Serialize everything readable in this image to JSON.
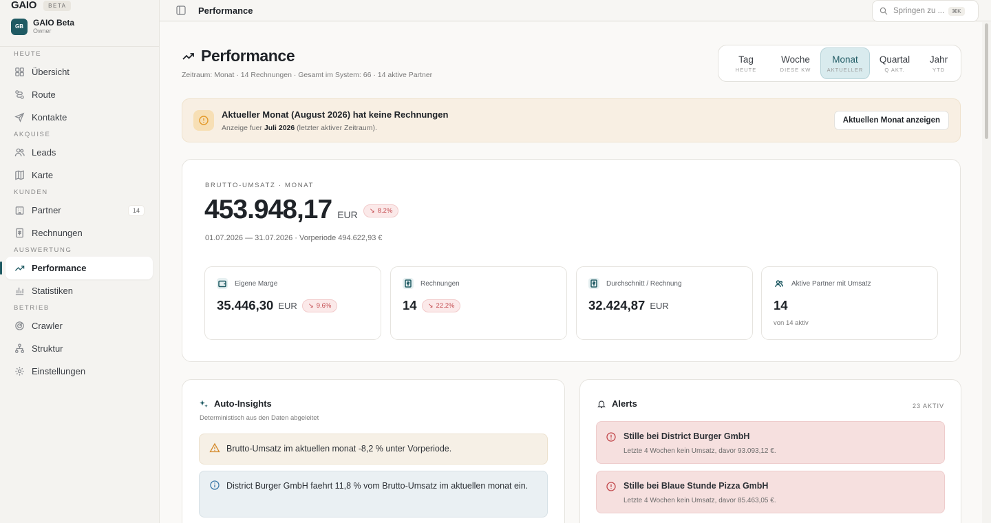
{
  "brand": {
    "name": "GAIO",
    "badge": "BETA"
  },
  "org": {
    "initials": "GB",
    "name": "GAIO Beta",
    "role": "Owner"
  },
  "nav": {
    "sections": [
      {
        "title": "HEUTE",
        "items": [
          {
            "label": "Übersicht",
            "icon": "grid-icon"
          },
          {
            "label": "Route",
            "icon": "route-icon"
          },
          {
            "label": "Kontakte",
            "icon": "send-icon"
          }
        ]
      },
      {
        "title": "AKQUISE",
        "items": [
          {
            "label": "Leads",
            "icon": "users-icon"
          },
          {
            "label": "Karte",
            "icon": "map-icon"
          }
        ]
      },
      {
        "title": "KUNDEN",
        "items": [
          {
            "label": "Partner",
            "icon": "building-icon",
            "count": "14"
          },
          {
            "label": "Rechnungen",
            "icon": "receipt-icon"
          }
        ]
      },
      {
        "title": "AUSWERTUNG",
        "items": [
          {
            "label": "Performance",
            "icon": "trend-icon",
            "active": true
          },
          {
            "label": "Statistiken",
            "icon": "bar-chart-icon"
          }
        ]
      },
      {
        "title": "BETRIEB",
        "items": [
          {
            "label": "Crawler",
            "icon": "radar-icon"
          },
          {
            "label": "Struktur",
            "icon": "hierarchy-icon"
          },
          {
            "label": "Einstellungen",
            "icon": "gear-icon"
          }
        ]
      }
    ]
  },
  "topbar": {
    "breadcrumb": "Performance",
    "search_placeholder": "Springen zu ...",
    "shortcut": "⌘K"
  },
  "page": {
    "title": "Performance",
    "subtitle": "Zeitraum: Monat · 14 Rechnungen · Gesamt im System: 66 · 14 aktive Partner"
  },
  "period_tabs": [
    {
      "label": "Tag",
      "sub": "HEUTE"
    },
    {
      "label": "Woche",
      "sub": "DIESE KW"
    },
    {
      "label": "Monat",
      "sub": "AKTUELLER",
      "active": true
    },
    {
      "label": "Quartal",
      "sub": "Q AKT."
    },
    {
      "label": "Jahr",
      "sub": "YTD"
    }
  ],
  "banner": {
    "title": "Aktueller Monat (August 2026) hat keine Rechnungen",
    "desc_prefix": "Anzeige fuer ",
    "desc_bold": "Juli 2026",
    "desc_suffix": " (letzter aktiver Zeitraum).",
    "button": "Aktuellen Monat anzeigen",
    "accent": "#f0a93b"
  },
  "revenue": {
    "eyebrow": "BRUTTO-UMSATZ · MONAT",
    "value": "453.948,17",
    "currency": "EUR",
    "delta": "8.2%",
    "range": "01.07.2026 — 31.07.2026 · Vorperiode 494.622,93 €"
  },
  "kpis": [
    {
      "label": "Eigene Marge",
      "value": "35.446,30",
      "currency": "EUR",
      "delta": "9.6%",
      "icon": "wallet-icon"
    },
    {
      "label": "Rechnungen",
      "value": "14",
      "delta": "22.2%",
      "icon": "invoice-icon"
    },
    {
      "label": "Durchschnitt / Rechnung",
      "value": "32.424,87",
      "currency": "EUR",
      "icon": "invoice-icon"
    },
    {
      "label": "Aktive Partner mit Umsatz",
      "value": "14",
      "note": "von 14 aktiv",
      "icon": "users-icon"
    }
  ],
  "insights": {
    "title": "Auto-Insights",
    "subtitle": "Deterministisch aus den Daten abgeleitet",
    "items": [
      {
        "kind": "warning",
        "text": "Brutto-Umsatz im aktuellen monat -8,2 % unter Vorperiode."
      },
      {
        "kind": "info",
        "text": "District Burger GmbH faehrt 11,8 % vom Brutto-Umsatz im aktuellen monat ein."
      }
    ]
  },
  "alerts": {
    "title": "Alerts",
    "count": "23 AKTIV",
    "items": [
      {
        "title": "Stille bei District Burger GmbH",
        "desc": "Letzte 4 Wochen kein Umsatz, davor 93.093,12 €."
      },
      {
        "title": "Stille bei Blaue Stunde Pizza GmbH",
        "desc": "Letzte 4 Wochen kein Umsatz, davor 85.463,05 €."
      }
    ]
  },
  "colors": {
    "accent": "#1f5a63",
    "negative": "#c2484c",
    "warning": "#f0a93b"
  }
}
